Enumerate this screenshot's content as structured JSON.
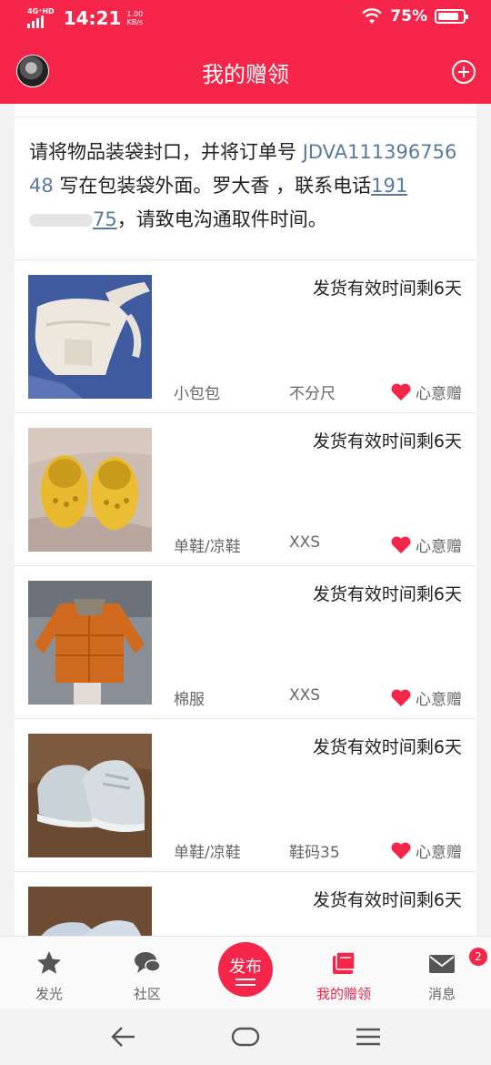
{
  "status_bar": {
    "network": "4G⁺HD",
    "time": "14:21",
    "speed_value": "1.00",
    "speed_unit": "KB/s",
    "battery": "75%"
  },
  "header": {
    "title": "我的赠领",
    "avatar_icon": "avatar",
    "add_icon": "plus-circle-icon"
  },
  "notice": {
    "part1": "请将物品装袋封口，并将订单号 ",
    "order_no": "JDVA11139675648",
    "part2": " 写在包装袋外面。罗大香 ，联系电话",
    "phone_prefix": "191",
    "phone_suffix": "75",
    "part3": "，请致电沟通取件时间。"
  },
  "items": [
    {
      "expire": "发货有效时间剩6天",
      "category": "小包包",
      "size": "不分尺",
      "gift": "心意赠"
    },
    {
      "expire": "发货有效时间剩6天",
      "category": "单鞋/凉鞋",
      "size": "XXS",
      "gift": "心意赠"
    },
    {
      "expire": "发货有效时间剩6天",
      "category": "棉服",
      "size": "XXS",
      "gift": "心意赠"
    },
    {
      "expire": "发货有效时间剩6天",
      "category": "单鞋/凉鞋",
      "size": "鞋码35",
      "gift": "心意赠"
    },
    {
      "expire": "发货有效时间剩6天"
    }
  ],
  "bottom_nav": {
    "tabs": [
      {
        "label": "发光",
        "icon": "star-icon"
      },
      {
        "label": "社区",
        "icon": "chat-bubbles-icon"
      },
      {
        "label": "发布",
        "icon": "publish-icon"
      },
      {
        "label": "我的赠领",
        "icon": "books-icon"
      },
      {
        "label": "消息",
        "icon": "mail-icon",
        "badge": "2"
      }
    ],
    "active_color": "#f5264a"
  },
  "colors": {
    "brand": "#f5264a",
    "link": "#5a7a9d"
  }
}
